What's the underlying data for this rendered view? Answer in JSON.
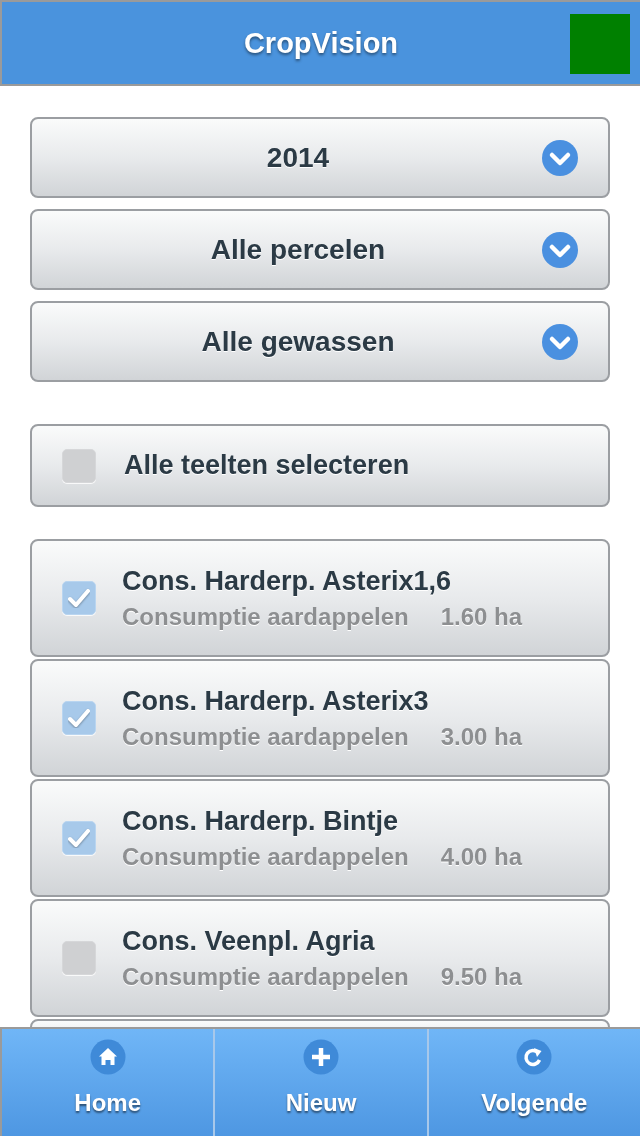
{
  "header": {
    "title": "CropVision"
  },
  "selects": [
    {
      "value": "2014"
    },
    {
      "value": "Alle percelen"
    },
    {
      "value": "Alle gewassen"
    }
  ],
  "select_all": {
    "label": "Alle teelten selecteren",
    "checked": false
  },
  "crops": [
    {
      "name": "Cons. Harderp. Asterix1,6",
      "crop": "Consumptie aardappelen",
      "area": "1.60 ha",
      "checked": true
    },
    {
      "name": "Cons. Harderp. Asterix3",
      "crop": "Consumptie aardappelen",
      "area": "3.00 ha",
      "checked": true
    },
    {
      "name": "Cons. Harderp. Bintje",
      "crop": "Consumptie aardappelen",
      "area": "4.00 ha",
      "checked": true
    },
    {
      "name": "Cons. Veenpl. Agria",
      "crop": "Consumptie aardappelen",
      "area": "9.50 ha",
      "checked": false
    }
  ],
  "tab_bar": [
    {
      "label": "Home",
      "kind": "home"
    },
    {
      "label": "Nieuw",
      "kind": "new"
    },
    {
      "label": "Volgende",
      "kind": "next"
    }
  ]
}
